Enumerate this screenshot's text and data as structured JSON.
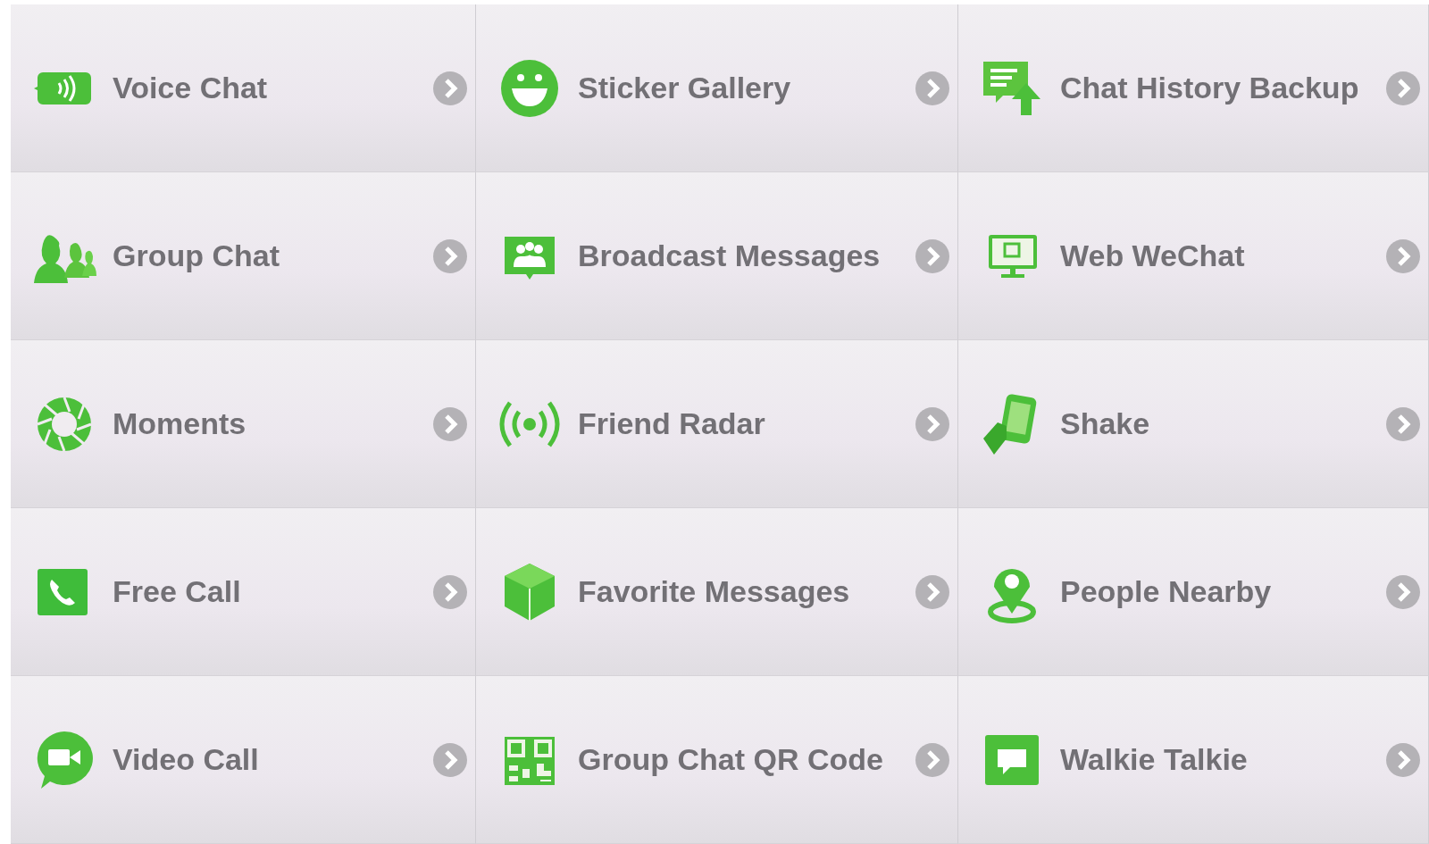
{
  "features": [
    {
      "kind": "voice",
      "label": "Voice Chat"
    },
    {
      "kind": "sticker",
      "label": "Sticker Gallery"
    },
    {
      "kind": "backup",
      "label": "Chat History Backup"
    },
    {
      "kind": "group",
      "label": "Group Chat"
    },
    {
      "kind": "broadcast",
      "label": "Broadcast Messages"
    },
    {
      "kind": "web",
      "label": "Web WeChat"
    },
    {
      "kind": "moments",
      "label": "Moments"
    },
    {
      "kind": "radar",
      "label": "Friend Radar"
    },
    {
      "kind": "shake",
      "label": "Shake"
    },
    {
      "kind": "call",
      "label": "Free Call"
    },
    {
      "kind": "favorite",
      "label": "Favorite Messages"
    },
    {
      "kind": "nearby",
      "label": "People Nearby"
    },
    {
      "kind": "video",
      "label": "Video Call"
    },
    {
      "kind": "qr",
      "label": "Group Chat QR Code"
    },
    {
      "kind": "walkie",
      "label": "Walkie Talkie"
    }
  ]
}
